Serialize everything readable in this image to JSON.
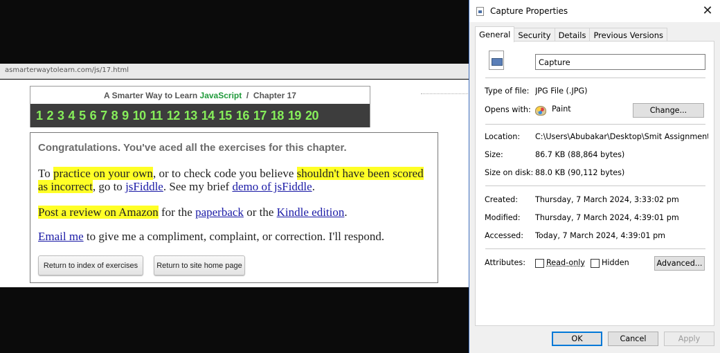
{
  "browser": {
    "url": "asmarterwaytolearn.com/js/17.html",
    "chapter_title_prefix": "A Smarter Way to Learn ",
    "chapter_title_brand": "JavaScript",
    "chapter_title_suffix": "  /  Chapter 17",
    "chapter_numbers": [
      "1",
      "2",
      "3",
      "4",
      "5",
      "6",
      "7",
      "8",
      "9",
      "10",
      "11",
      "12",
      "13",
      "14",
      "15",
      "16",
      "17",
      "18",
      "19",
      "20"
    ],
    "congrats": "Congratulations. You've aced all the exercises for this chapter.",
    "p1": {
      "t1": "To ",
      "h1": "practice on your own",
      "t2": ", or to check code you believe ",
      "h2": "shouldn't have been scored as incorrect",
      "t3": ", go to ",
      "l1": "jsFiddle",
      "t4": ". See my brief ",
      "l2": "demo of jsFiddle",
      "t5": "."
    },
    "p2": {
      "h1": "Post a review on Amazon",
      "t1": " for the ",
      "l1": "paperback",
      "t2": " or the ",
      "l2": "Kindle edition",
      "t3": "."
    },
    "p3": {
      "l1": "Email me",
      "t1": " to give me a compliment, complaint, or correction. I'll respond."
    },
    "btn_index": "Return to index of exercises",
    "btn_home": "Return to site home page",
    "colors": {
      "highlight": "#ffff26",
      "nav_number": "#86ee5a",
      "brand": "#1f9a3a"
    }
  },
  "dialog": {
    "title": "Capture Properties",
    "tabs": [
      "General",
      "Security",
      "Details",
      "Previous Versions"
    ],
    "filename": "Capture",
    "labels": {
      "type": "Type of file:",
      "opens": "Opens with:",
      "location": "Location:",
      "size": "Size:",
      "size_disk": "Size on disk:",
      "created": "Created:",
      "modified": "Modified:",
      "accessed": "Accessed:",
      "attributes": "Attributes:"
    },
    "values": {
      "type": "JPG File (.JPG)",
      "opens": "Paint",
      "location": "C:\\Users\\Abubakar\\Desktop\\Smit Assignments\\Ass",
      "size": "86.7 KB (88,864 bytes)",
      "size_disk": "88.0 KB (90,112 bytes)",
      "created": "Thursday, 7 March 2024, 3:33:02 pm",
      "modified": "Thursday, 7 March 2024, 4:39:01 pm",
      "accessed": "Today, 7 March 2024, 4:39:01 pm"
    },
    "change_btn": "Change...",
    "readonly_label": "Read-only",
    "hidden_label": "Hidden",
    "advanced_btn": "Advanced...",
    "ok": "OK",
    "cancel": "Cancel",
    "apply": "Apply"
  }
}
